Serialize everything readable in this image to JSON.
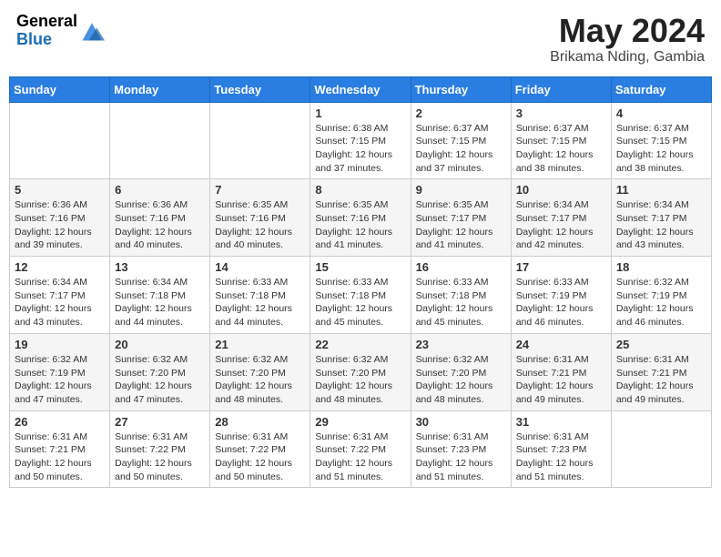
{
  "header": {
    "logo": {
      "line1": "General",
      "line2": "Blue"
    },
    "title": "May 2024",
    "subtitle": "Brikama Nding, Gambia"
  },
  "days_of_week": [
    "Sunday",
    "Monday",
    "Tuesday",
    "Wednesday",
    "Thursday",
    "Friday",
    "Saturday"
  ],
  "weeks": [
    [
      {
        "day": "",
        "info": ""
      },
      {
        "day": "",
        "info": ""
      },
      {
        "day": "",
        "info": ""
      },
      {
        "day": "1",
        "info": "Sunrise: 6:38 AM\nSunset: 7:15 PM\nDaylight: 12 hours\nand 37 minutes."
      },
      {
        "day": "2",
        "info": "Sunrise: 6:37 AM\nSunset: 7:15 PM\nDaylight: 12 hours\nand 37 minutes."
      },
      {
        "day": "3",
        "info": "Sunrise: 6:37 AM\nSunset: 7:15 PM\nDaylight: 12 hours\nand 38 minutes."
      },
      {
        "day": "4",
        "info": "Sunrise: 6:37 AM\nSunset: 7:15 PM\nDaylight: 12 hours\nand 38 minutes."
      }
    ],
    [
      {
        "day": "5",
        "info": "Sunrise: 6:36 AM\nSunset: 7:16 PM\nDaylight: 12 hours\nand 39 minutes."
      },
      {
        "day": "6",
        "info": "Sunrise: 6:36 AM\nSunset: 7:16 PM\nDaylight: 12 hours\nand 40 minutes."
      },
      {
        "day": "7",
        "info": "Sunrise: 6:35 AM\nSunset: 7:16 PM\nDaylight: 12 hours\nand 40 minutes."
      },
      {
        "day": "8",
        "info": "Sunrise: 6:35 AM\nSunset: 7:16 PM\nDaylight: 12 hours\nand 41 minutes."
      },
      {
        "day": "9",
        "info": "Sunrise: 6:35 AM\nSunset: 7:17 PM\nDaylight: 12 hours\nand 41 minutes."
      },
      {
        "day": "10",
        "info": "Sunrise: 6:34 AM\nSunset: 7:17 PM\nDaylight: 12 hours\nand 42 minutes."
      },
      {
        "day": "11",
        "info": "Sunrise: 6:34 AM\nSunset: 7:17 PM\nDaylight: 12 hours\nand 43 minutes."
      }
    ],
    [
      {
        "day": "12",
        "info": "Sunrise: 6:34 AM\nSunset: 7:17 PM\nDaylight: 12 hours\nand 43 minutes."
      },
      {
        "day": "13",
        "info": "Sunrise: 6:34 AM\nSunset: 7:18 PM\nDaylight: 12 hours\nand 44 minutes."
      },
      {
        "day": "14",
        "info": "Sunrise: 6:33 AM\nSunset: 7:18 PM\nDaylight: 12 hours\nand 44 minutes."
      },
      {
        "day": "15",
        "info": "Sunrise: 6:33 AM\nSunset: 7:18 PM\nDaylight: 12 hours\nand 45 minutes."
      },
      {
        "day": "16",
        "info": "Sunrise: 6:33 AM\nSunset: 7:18 PM\nDaylight: 12 hours\nand 45 minutes."
      },
      {
        "day": "17",
        "info": "Sunrise: 6:33 AM\nSunset: 7:19 PM\nDaylight: 12 hours\nand 46 minutes."
      },
      {
        "day": "18",
        "info": "Sunrise: 6:32 AM\nSunset: 7:19 PM\nDaylight: 12 hours\nand 46 minutes."
      }
    ],
    [
      {
        "day": "19",
        "info": "Sunrise: 6:32 AM\nSunset: 7:19 PM\nDaylight: 12 hours\nand 47 minutes."
      },
      {
        "day": "20",
        "info": "Sunrise: 6:32 AM\nSunset: 7:20 PM\nDaylight: 12 hours\nand 47 minutes."
      },
      {
        "day": "21",
        "info": "Sunrise: 6:32 AM\nSunset: 7:20 PM\nDaylight: 12 hours\nand 48 minutes."
      },
      {
        "day": "22",
        "info": "Sunrise: 6:32 AM\nSunset: 7:20 PM\nDaylight: 12 hours\nand 48 minutes."
      },
      {
        "day": "23",
        "info": "Sunrise: 6:32 AM\nSunset: 7:20 PM\nDaylight: 12 hours\nand 48 minutes."
      },
      {
        "day": "24",
        "info": "Sunrise: 6:31 AM\nSunset: 7:21 PM\nDaylight: 12 hours\nand 49 minutes."
      },
      {
        "day": "25",
        "info": "Sunrise: 6:31 AM\nSunset: 7:21 PM\nDaylight: 12 hours\nand 49 minutes."
      }
    ],
    [
      {
        "day": "26",
        "info": "Sunrise: 6:31 AM\nSunset: 7:21 PM\nDaylight: 12 hours\nand 50 minutes."
      },
      {
        "day": "27",
        "info": "Sunrise: 6:31 AM\nSunset: 7:22 PM\nDaylight: 12 hours\nand 50 minutes."
      },
      {
        "day": "28",
        "info": "Sunrise: 6:31 AM\nSunset: 7:22 PM\nDaylight: 12 hours\nand 50 minutes."
      },
      {
        "day": "29",
        "info": "Sunrise: 6:31 AM\nSunset: 7:22 PM\nDaylight: 12 hours\nand 51 minutes."
      },
      {
        "day": "30",
        "info": "Sunrise: 6:31 AM\nSunset: 7:23 PM\nDaylight: 12 hours\nand 51 minutes."
      },
      {
        "day": "31",
        "info": "Sunrise: 6:31 AM\nSunset: 7:23 PM\nDaylight: 12 hours\nand 51 minutes."
      },
      {
        "day": "",
        "info": ""
      }
    ]
  ]
}
